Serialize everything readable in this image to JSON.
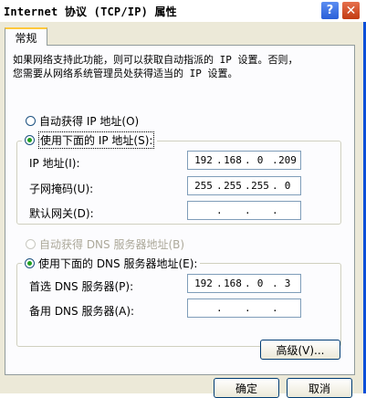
{
  "window": {
    "title": "Internet 协议 (TCP/IP) 属性",
    "help_glyph": "?",
    "close_glyph": "✕"
  },
  "tabs": [
    {
      "label": "常规",
      "active": true
    }
  ],
  "general": {
    "description_line1": "如果网络支持此功能，则可以获取自动指派的 IP 设置。否则，",
    "description_line2": "您需要从网络系统管理员处获得适当的 IP 设置。",
    "auto_ip_label": "自动获得 IP 地址(O)",
    "manual_ip_label": "使用下面的 IP 地址(S):",
    "ip_selected": "manual",
    "fields": {
      "ip_address": {
        "label": "IP 地址(I):",
        "octets": [
          "192",
          "168",
          "0",
          "209"
        ]
      },
      "subnet_mask": {
        "label": "子网掩码(U):",
        "octets": [
          "255",
          "255",
          "255",
          "0"
        ]
      },
      "gateway": {
        "label": "默认网关(D):",
        "octets": [
          "",
          "",
          "",
          ""
        ]
      }
    },
    "auto_dns_label": "自动获得 DNS 服务器地址(B)",
    "manual_dns_label": "使用下面的 DNS 服务器地址(E):",
    "dns_selected": "manual",
    "dns_fields": {
      "preferred": {
        "label": "首选 DNS 服务器(P):",
        "octets": [
          "192",
          "168",
          "0",
          "3"
        ]
      },
      "alternate": {
        "label": "备用 DNS 服务器(A):",
        "octets": [
          "",
          "",
          "",
          ""
        ]
      }
    },
    "advanced_button": "高级(V)..."
  },
  "footer": {
    "ok_button": "确定",
    "cancel_button": "取消"
  },
  "colors": {
    "accent": "#0a4fd8",
    "radio_dot": "#21a121",
    "face": "#ece9d8"
  }
}
